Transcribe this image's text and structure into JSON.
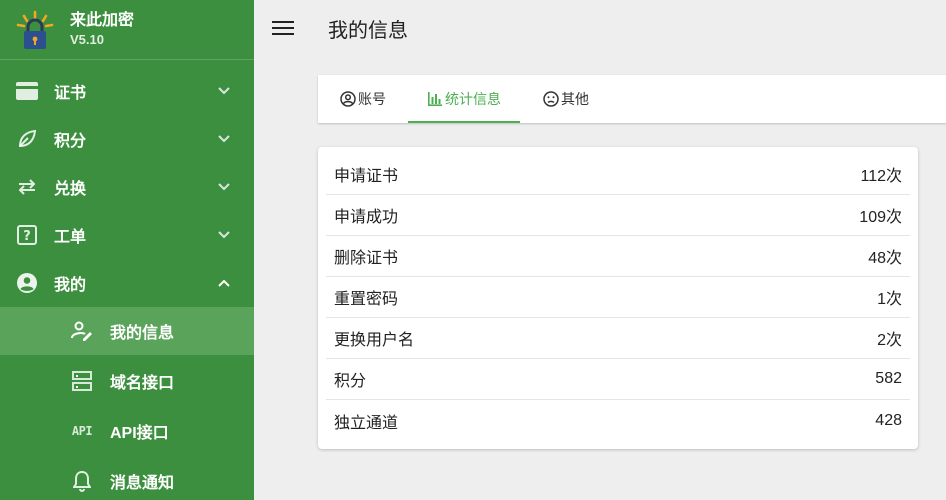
{
  "app": {
    "title": "来此加密",
    "version": "V5.10"
  },
  "sidebar": {
    "items": [
      {
        "label": "证书",
        "icon": "credit-card-icon"
      },
      {
        "label": "积分",
        "icon": "leaf-icon"
      },
      {
        "label": "兑换",
        "icon": "swap-arrows-icon"
      },
      {
        "label": "工单",
        "icon": "help-box-icon"
      },
      {
        "label": "我的",
        "icon": "account-circle-icon"
      }
    ],
    "subitems": [
      {
        "label": "我的信息",
        "icon": "account-edit-icon"
      },
      {
        "label": "域名接口",
        "icon": "server-icon"
      },
      {
        "label": "API接口",
        "icon": "api-icon",
        "glyph": "API"
      },
      {
        "label": "消息通知",
        "icon": "bell-icon"
      }
    ]
  },
  "header": {
    "title": "我的信息"
  },
  "tabs": [
    {
      "label": "账号",
      "icon": "account-circle-outline-icon"
    },
    {
      "label": "统计信息",
      "icon": "bar-chart-icon"
    },
    {
      "label": "其他",
      "icon": "emoticon-sad-icon"
    }
  ],
  "stats": [
    {
      "label": "申请证书",
      "value": "112次"
    },
    {
      "label": "申请成功",
      "value": "109次"
    },
    {
      "label": "删除证书",
      "value": "48次"
    },
    {
      "label": "重置密码",
      "value": "1次"
    },
    {
      "label": "更换用户名",
      "value": "2次"
    },
    {
      "label": "积分",
      "value": "582"
    },
    {
      "label": "独立通道",
      "value": "428"
    }
  ],
  "colors": {
    "sidebar": "#3b8f3e",
    "sidebar_active": "#5aa35a",
    "accent": "#4caf50",
    "background": "#eeeeee"
  }
}
